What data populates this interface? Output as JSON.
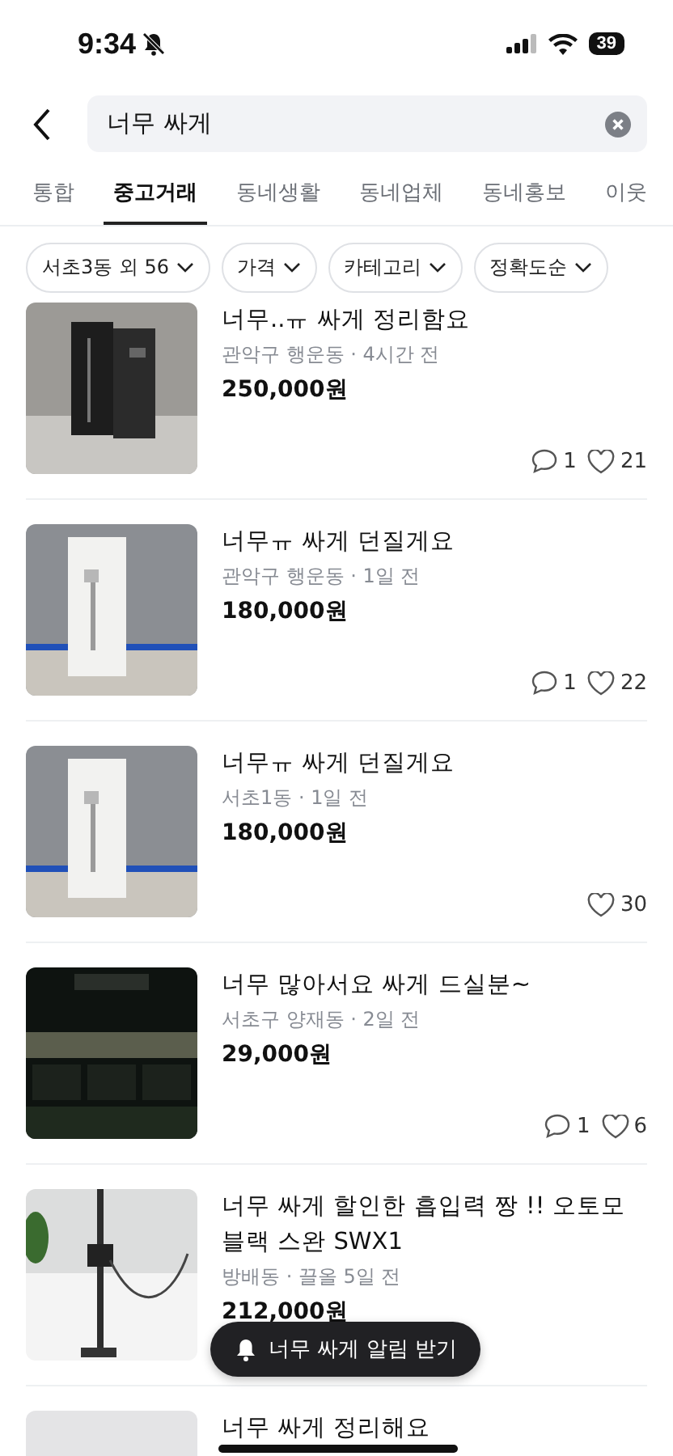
{
  "status_bar": {
    "time": "9:34",
    "battery": "39"
  },
  "search": {
    "value": "너무 싸게"
  },
  "tabs": [
    {
      "label": "통합",
      "selected": false
    },
    {
      "label": "중고거래",
      "selected": true
    },
    {
      "label": "동네생활",
      "selected": false
    },
    {
      "label": "동네업체",
      "selected": false
    },
    {
      "label": "동네홍보",
      "selected": false
    },
    {
      "label": "이웃",
      "selected": false
    }
  ],
  "filters": [
    {
      "label": "서초3동 외 56"
    },
    {
      "label": "가격"
    },
    {
      "label": "카테고리"
    },
    {
      "label": "정확도순"
    }
  ],
  "listings": [
    {
      "title": "너무..ㅠ 싸게 정리함요",
      "meta": "관악구 행운동 · 4시간 전",
      "price": "250,000원",
      "comments": "1",
      "likes": "21"
    },
    {
      "title": "너무ㅠ 싸게 던질게요",
      "meta": "관악구 행운동 · 1일 전",
      "price": "180,000원",
      "comments": "1",
      "likes": "22"
    },
    {
      "title": "너무ㅠ 싸게 던질게요",
      "meta": "서초1동 · 1일 전",
      "price": "180,000원",
      "likes": "30"
    },
    {
      "title": "너무 많아서요 싸게 드실분~",
      "meta": "서초구 양재동 · 2일 전",
      "price": "29,000원",
      "comments": "1",
      "likes": "6"
    },
    {
      "title": "너무 싸게 할인한 흡입력 짱 !! 오토모 블랙 스완 SWX1",
      "meta": "방배동 · 끌올 5일 전",
      "price": "212,000원"
    },
    {
      "title": "너무 싸게 정리해요"
    }
  ],
  "floating_button": {
    "label": "너무 싸게 알림 받기"
  }
}
